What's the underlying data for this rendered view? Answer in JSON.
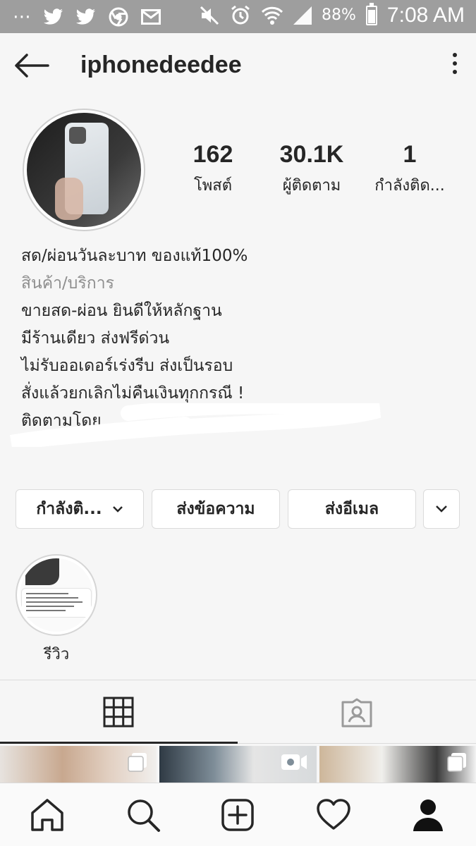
{
  "status_bar": {
    "left_icons": [
      "more-dots-icon",
      "twitter-icon",
      "twitter-icon",
      "chrome-icon",
      "mail-icon"
    ],
    "right_icons": [
      "mute-icon",
      "alarm-icon",
      "wifi-icon",
      "signal-icon",
      "battery-icon"
    ],
    "battery_percent": "88%",
    "battery_level": 0.88,
    "time": "7:08 AM"
  },
  "header": {
    "username": "iphonedeedee"
  },
  "stats": {
    "posts": {
      "value": "162",
      "label": "โพสต์"
    },
    "followers": {
      "value": "30.1K",
      "label": "ผู้ติดตาม"
    },
    "following": {
      "value": "1",
      "label": "กำลังติด..."
    }
  },
  "bio": {
    "name": "สด/ผ่อนวันละบาท ของแท้100%",
    "category": "สินค้า/บริการ",
    "lines": [
      "ขายสด-ผ่อน ยินดีให้หลักฐาน",
      "มีร้านเดียว ส่งฟรีด่วน",
      "ไม่รับออเดอร์เร่งรีบ ส่งเป็นรอบ",
      "สั่งแล้วยกเลิกไม่คืนเงินทุกกรณี !",
      "ติดตามโดย"
    ]
  },
  "actions": {
    "following_button": "กำลังติ...",
    "message_button": "ส่งข้อความ",
    "email_button": "ส่งอีเมล"
  },
  "highlights": [
    {
      "label": "รีวิว"
    }
  ],
  "tabs": [
    "grid-icon",
    "tagged-icon"
  ],
  "colors": {
    "status_bar": "#9e9e9e",
    "background": "#f6f6f6",
    "text": "#262626",
    "secondary_text": "#8e8e8e",
    "border": "#dbdbdb"
  }
}
